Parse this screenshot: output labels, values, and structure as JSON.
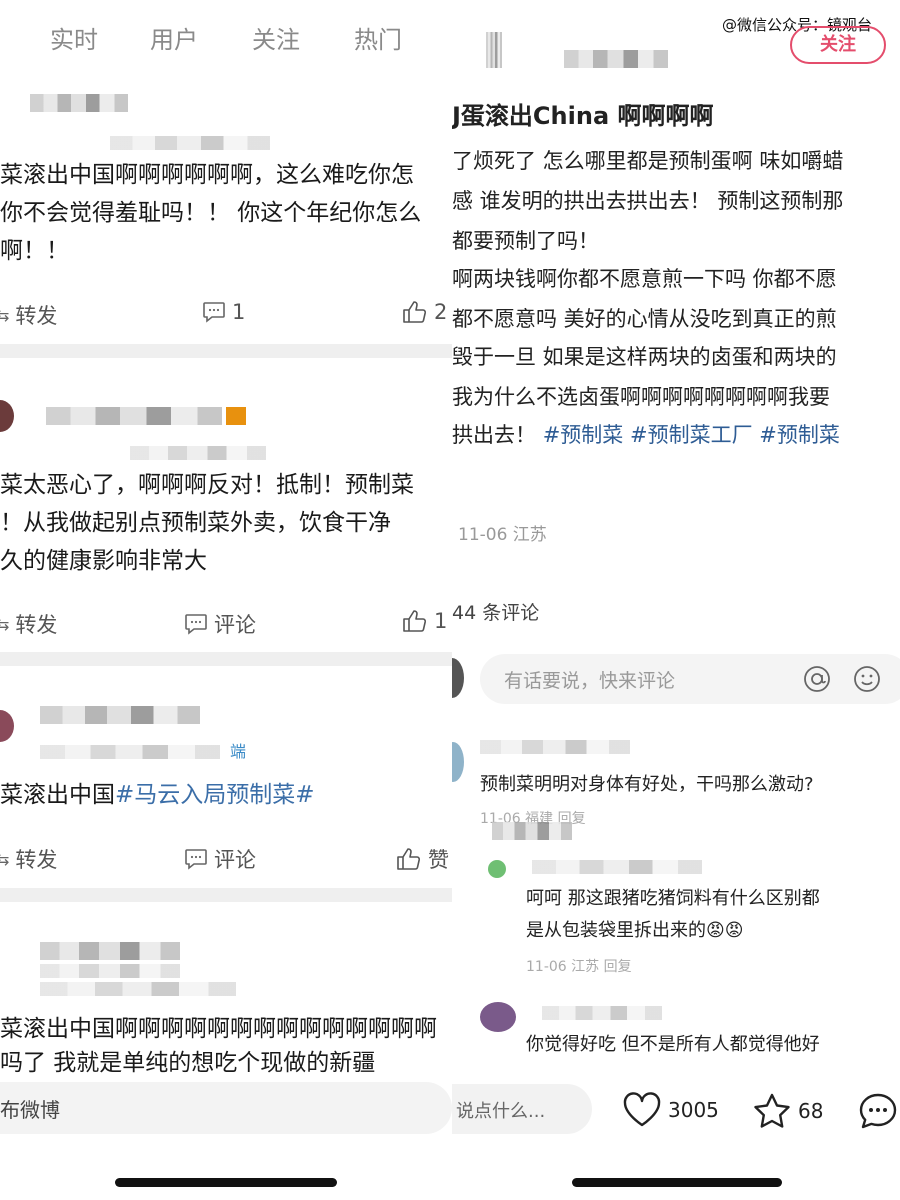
{
  "watermark": "@微信公众号：镜观台",
  "left": {
    "tabs": [
      "实时",
      "用户",
      "关注",
      "热门"
    ],
    "posts": [
      {
        "lines": [
          "菜滚出中国啊啊啊啊啊啊，这么难吃你怎",
          "你不会觉得羞耻吗！！ 你这个年纪你怎么",
          "啊！！"
        ],
        "repost": "转发",
        "comment": "1",
        "like": "2"
      },
      {
        "lines": [
          "菜太恶心了，啊啊啊反对！抵制！预制菜",
          "！从我做起别点预制菜外卖，饮食干净",
          "久的健康影响非常大"
        ],
        "repost": "转发",
        "comment": "评论",
        "like": "1"
      },
      {
        "client_tag": "端",
        "line_plain": "菜滚出中国",
        "line_hashtag": "#马云入局预制菜#",
        "repost": "转发",
        "comment": "评论",
        "like": "赞"
      },
      {
        "lines": [
          "菜滚出中国啊啊啊啊啊啊啊啊啊啊啊啊啊啊",
          "吗了  我就是单纯的想吃个现做的新疆"
        ]
      }
    ],
    "compose_placeholder": "布微博"
  },
  "right": {
    "follow_label": "关注",
    "title": "J蛋滚出China 啊啊啊啊",
    "body_lines": [
      "了烦死了 怎么哪里都是预制蛋啊 味如嚼蜡",
      "感 谁发明的拱出去拱出去！ 预制这预制那",
      "都要预制了吗！",
      "啊两块钱啊你都不愿意煎一下吗 你都不愿",
      "都不愿意吗 美好的心情从没吃到真正的煎",
      "毁于一旦 如果是这样两块的卤蛋和两块的",
      "我为什么不选卤蛋啊啊啊啊啊啊啊啊我要"
    ],
    "last_line_prefix": "拱出去！",
    "hashtags": [
      "#预制菜",
      "#预制菜工厂",
      "#预制菜"
    ],
    "post_meta": "11-06 江苏",
    "comment_count": "44 条评论",
    "comment_placeholder": "有话要说，快来评论",
    "comments": [
      {
        "text": "预制菜明明对身体有好处，干吗那么激动?",
        "meta": "11-06 福建 回复"
      },
      {
        "text_lines": [
          "呵呵 那这跟猪吃猪饲料有什么区别都",
          "是从包装袋里拆出来的"
        ],
        "emoji": "😡😡",
        "meta": "11-06 江苏 回复"
      },
      {
        "text": "你觉得好吃 但不是所有人都觉得他好"
      }
    ],
    "bottom": {
      "input_placeholder": "说点什么...",
      "likes": "3005",
      "favorites": "68"
    }
  }
}
